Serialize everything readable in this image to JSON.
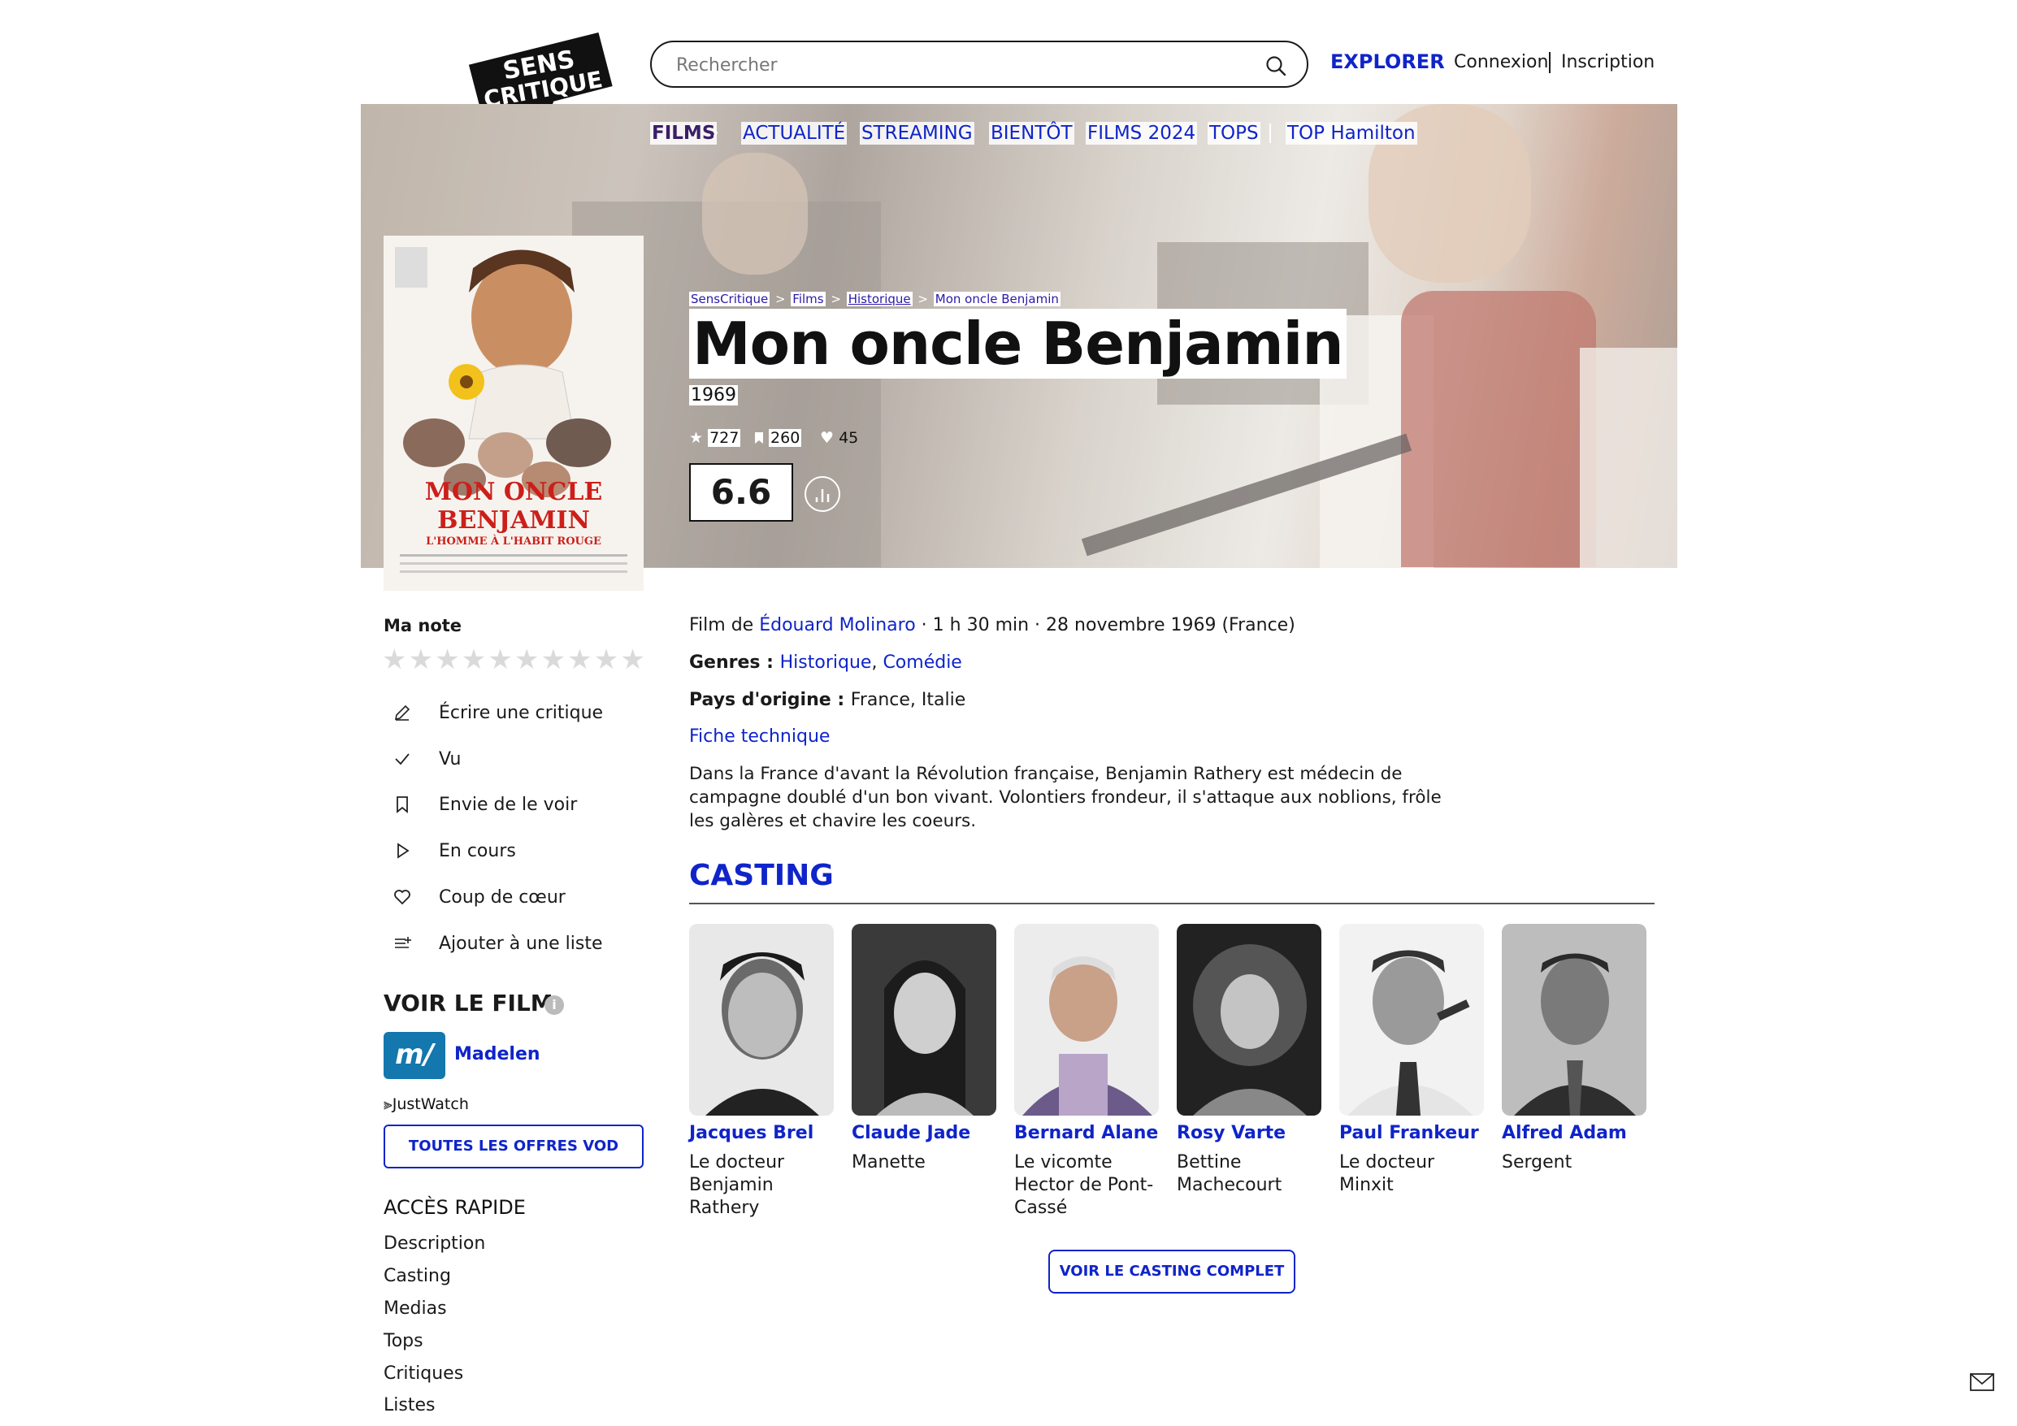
{
  "header": {
    "logo_text_line1": "SENS",
    "logo_text_line2": "CRITIQUE",
    "search_placeholder": "Rechercher",
    "explorer_label": "EXPLORER",
    "connexion_label": "Connexion",
    "inscription_label": "Inscription"
  },
  "nav": {
    "items": [
      "FILMS",
      "ACTUALITÉ",
      "STREAMING",
      "BIENTÔT",
      "FILMS 2024",
      "TOPS",
      "TOP Hamilton"
    ]
  },
  "poster": {
    "title_line1": "MON ONCLE",
    "title_line2": "BENJAMIN",
    "subtitle": "L'HOMME À L'HABIT ROUGE"
  },
  "breadcrumb": [
    "SensCritique",
    "Films",
    "Historique",
    "Mon oncle Benjamin"
  ],
  "movie": {
    "title": "Mon oncle Benjamin",
    "year": "1969",
    "ratings_count": "727",
    "wishlist_count": "260",
    "favorites_count": "45",
    "score": "6.6",
    "film_de_prefix": "Film de ",
    "director": "Édouard Molinaro",
    "details": " · 1 h 30 min · 28 novembre 1969 (France)",
    "genres_label": "Genres : ",
    "genres": [
      "Historique",
      "Comédie"
    ],
    "pays_label": "Pays d'origine : ",
    "pays": "France, Italie",
    "fiche_label": "Fiche technique",
    "synopsis": "Dans la France d'avant la Révolution française, Benjamin Rathery est médecin de campagne doublé d'un bon vivant. Volontiers frondeur, il s'attaque aux noblions, frôle les galères et chavire les coeurs."
  },
  "sidebar": {
    "ma_note_label": "Ma note",
    "actions": [
      "Écrire une critique",
      "Vu",
      "Envie de le voir",
      "En cours",
      "Coup de cœur",
      "Ajouter à une liste"
    ],
    "voir_le_film_title": "VOIR LE FILM",
    "provider_logo_text": "m/",
    "provider_name": "Madelen",
    "justwatch_label": "JustWatch",
    "vod_button": "TOUTES LES OFFRES VOD",
    "acces_rapide_title": "ACCÈS RAPIDE",
    "quick_links": [
      "Description",
      "Casting",
      "Medias",
      "Tops",
      "Critiques",
      "Listes"
    ]
  },
  "casting": {
    "title": "CASTING",
    "members": [
      {
        "name": "Jacques Brel",
        "role": "Le docteur Benjamin Rathery"
      },
      {
        "name": "Claude Jade",
        "role": "Manette"
      },
      {
        "name": "Bernard Alane",
        "role": "Le vicomte Hector de Pont-Cassé"
      },
      {
        "name": "Rosy Varte",
        "role": "Bettine Machecourt"
      },
      {
        "name": "Paul Frankeur",
        "role": "Le docteur Minxit"
      },
      {
        "name": "Alfred Adam",
        "role": "Sergent"
      }
    ],
    "button_label": "VOIR LE CASTING COMPLET"
  },
  "colors": {
    "accent": "#0f24c9",
    "nav_active": "#3a1e66",
    "madelen": "#1477ae"
  },
  "icons": [
    "search-icon",
    "chevron-right-icon",
    "star-icon",
    "bookmark-icon",
    "heart-icon",
    "stats-chart-icon",
    "pencil-icon",
    "check-icon",
    "play-icon",
    "list-add-icon",
    "info-icon",
    "mail-icon"
  ]
}
